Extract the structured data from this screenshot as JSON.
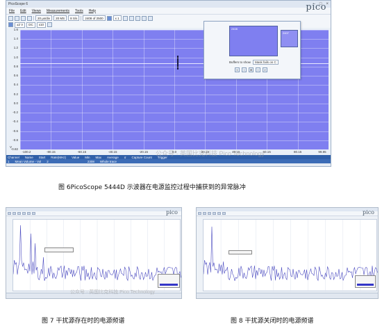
{
  "main": {
    "title": "PicoScope 6",
    "menu": [
      "File",
      "Edit",
      "Views",
      "Measurements",
      "Tools",
      "Help"
    ],
    "logo": "pico",
    "toolbar": {
      "timebase": "20 µs/div",
      "samples": "20 MS",
      "rate": "8 S/s",
      "buffer": "2408 of 2500",
      "zoom": "x 1"
    },
    "channel": {
      "range": "±2 V",
      "coupling": "DC",
      "probe": "x10"
    },
    "y_ticks": [
      "1.6",
      "1.4",
      "1.2",
      "1.0",
      "0.8",
      "0.6",
      "0.4",
      "0.2",
      "0.0",
      "-0.2",
      "-0.4",
      "-0.6",
      "-0.8",
      "-0.82"
    ],
    "y_unit": "V",
    "x_ticks": [
      "-100.2",
      "-80.15",
      "-60.15",
      "-40.15",
      "-20.15",
      "0.0",
      "20.15",
      "40.15",
      "60.15",
      "80.15",
      "99.85"
    ],
    "x_unit": "µs",
    "status_headers": [
      "Channel",
      "Name",
      "Start",
      "Rate(MHz)",
      "Value",
      "Min",
      "Max",
      "Average",
      "σ",
      "Capture Count",
      "Trigger"
    ],
    "status_row": [
      "1",
      "Mean Volume - Vol",
      "2",
      "",
      "",
      "",
      "",
      "",
      "",
      "2308",
      "Whole trace"
    ],
    "overview": {
      "thumb1_tag": "2408",
      "thumb2_tag": "2407",
      "buffers_label": "Buffers to show",
      "buffers_value": "Mask fails on C"
    }
  },
  "captions": {
    "fig6": "图 6PicoScope 5444D 示波器在电源监控过程中捕获到的异常脉冲",
    "fig7": "图 7   干扰源存在时的电源频谱",
    "fig8": "图 8   干扰源关闭时的电源频谱"
  },
  "watermarks": {
    "main": "公众号 · 英国比克科技 Pico Technology",
    "mini": "公众号 · 英国比克科技 Pico Technology"
  },
  "mini_logo": "pico",
  "colors": {
    "plot_bg": "#7f7ff0",
    "status_blue": "#2f5fa8",
    "spectrum_line": "#4a4ac0"
  }
}
